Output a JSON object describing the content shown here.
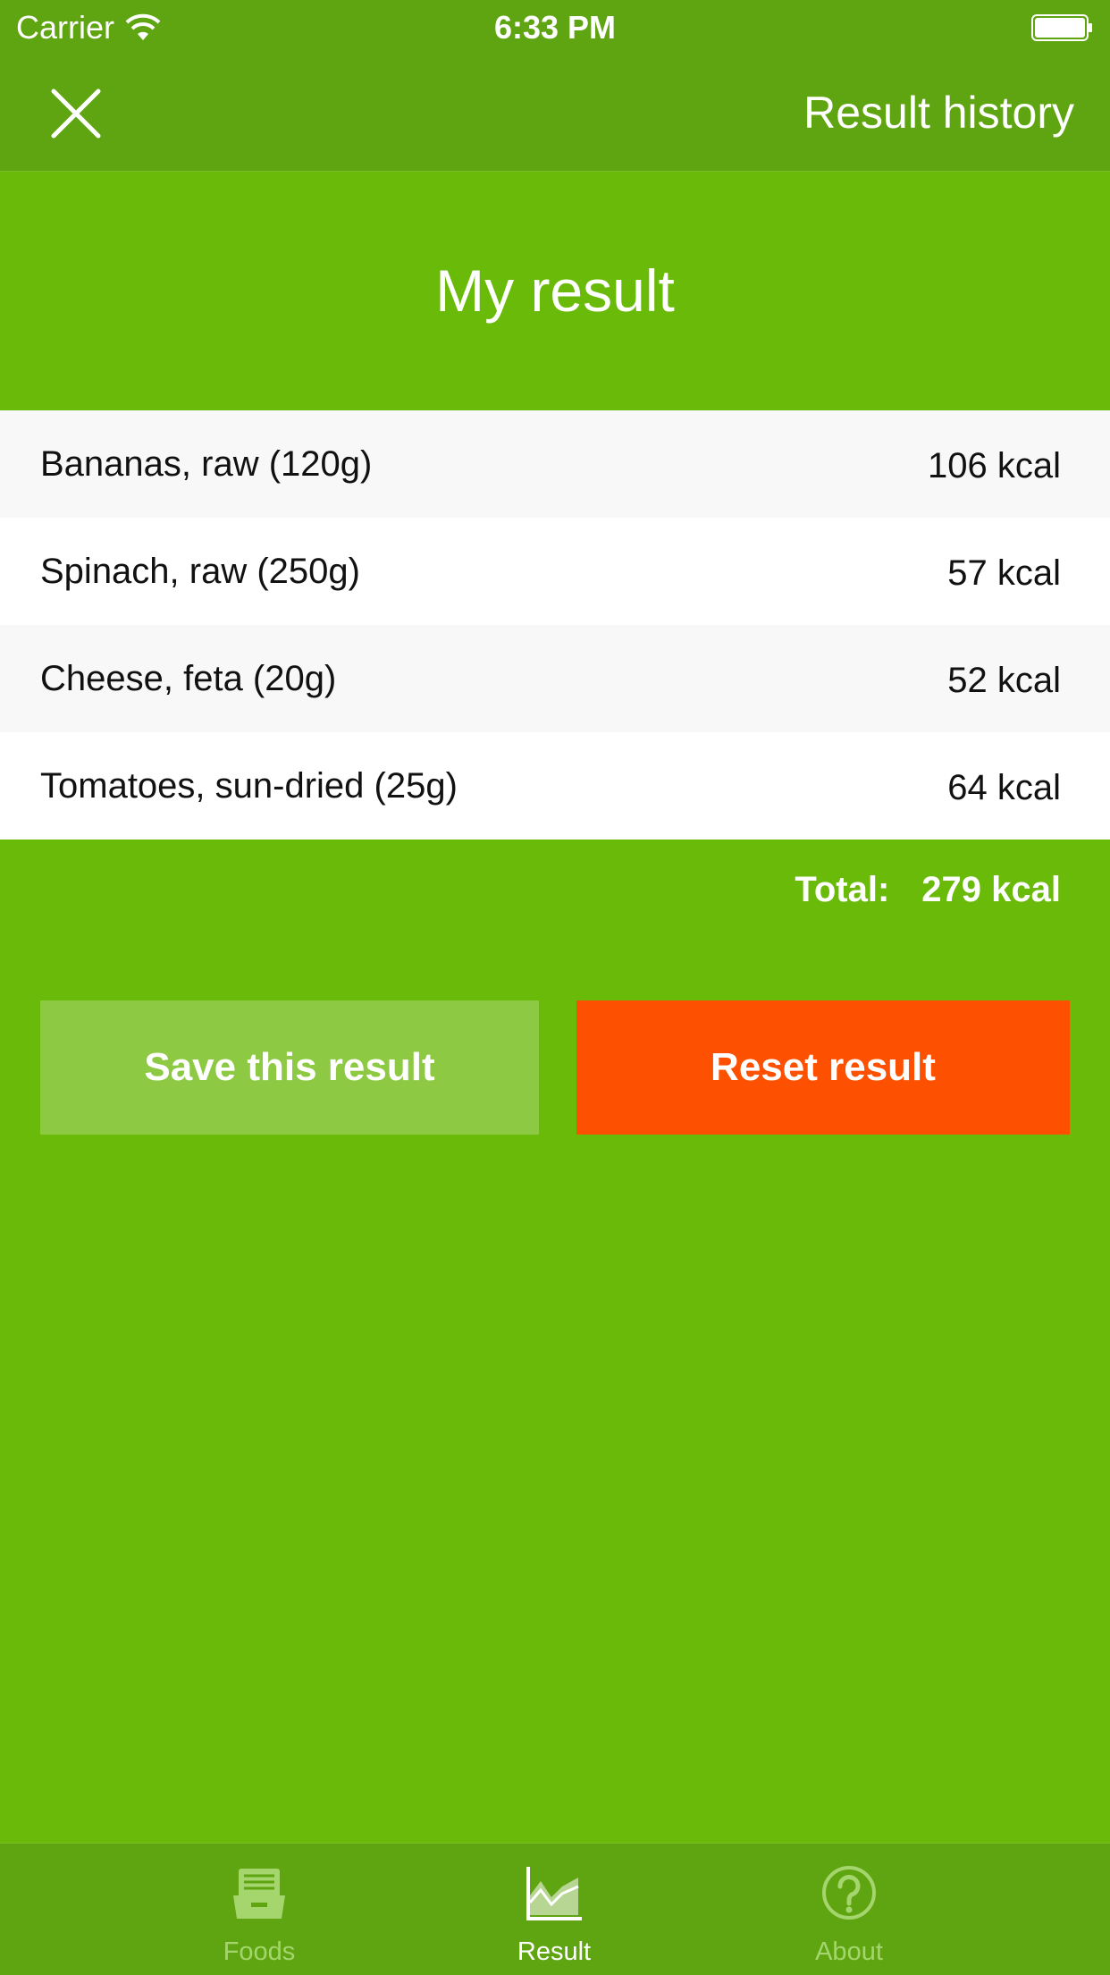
{
  "status_bar": {
    "carrier": "Carrier",
    "time": "6:33 PM",
    "icons": [
      "wifi-icon",
      "battery-icon"
    ]
  },
  "nav": {
    "close_icon": "close-icon",
    "history_label": "Result history"
  },
  "page": {
    "title": "My result"
  },
  "foods": [
    {
      "name": "Bananas, raw (120g)",
      "kcal": "106 kcal"
    },
    {
      "name": "Spinach, raw (250g)",
      "kcal": "57 kcal"
    },
    {
      "name": "Cheese, feta (20g)",
      "kcal": "52 kcal"
    },
    {
      "name": "Tomatoes, sun-dried (25g)",
      "kcal": "64 kcal"
    }
  ],
  "total": {
    "label": "Total:",
    "value": "279 kcal"
  },
  "actions": {
    "save_label": "Save this result",
    "reset_label": "Reset result"
  },
  "tabs": [
    {
      "label": "Foods",
      "icon": "foods-icon",
      "selected": false
    },
    {
      "label": "Result",
      "icon": "chart-icon",
      "selected": true
    },
    {
      "label": "About",
      "icon": "question-icon",
      "selected": false
    }
  ],
  "colors": {
    "background": "#6aba09",
    "bar": "#5fa411",
    "save_button": "#8dc943",
    "reset_button": "#fd5000",
    "tab_inactive": "#a5d56d",
    "tab_active": "#ffffff"
  }
}
